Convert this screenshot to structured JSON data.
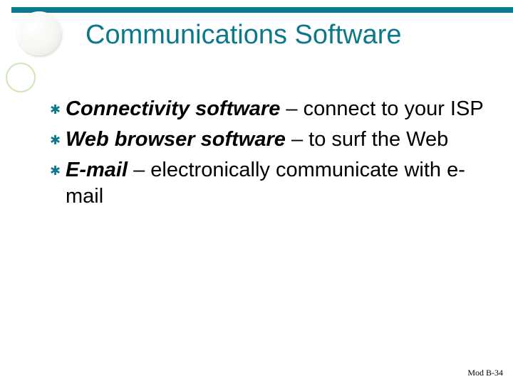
{
  "title": "Communications Software",
  "items": [
    {
      "term": "Connectivity software",
      "rest": " – connect to your ISP"
    },
    {
      "term": "Web browser software",
      "rest": " – to surf the Web"
    },
    {
      "term": "E-mail",
      "rest": " – electronically communicate with e-mail"
    }
  ],
  "bullet_glyph": "✱",
  "footer": "Mod B-34"
}
